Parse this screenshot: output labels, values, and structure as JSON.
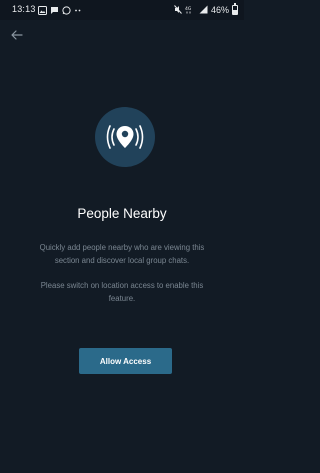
{
  "status_bar": {
    "time": "13:13",
    "battery_text": "46%",
    "battery_level": 0.46,
    "left_icons": [
      "image-icon",
      "message-icon",
      "whatsapp-icon",
      "more-dots-icon"
    ],
    "right_icons": [
      "mute-icon",
      "network-icon",
      "signal-icon",
      "battery-icon"
    ]
  },
  "header": {
    "back_icon": "back-arrow-icon"
  },
  "hero": {
    "icon": "location-pin-icon",
    "circle_color": "#21425a"
  },
  "content": {
    "title": "People Nearby",
    "description": "Quickly add people nearby who are viewing this section and discover local group chats.",
    "hint": "Please switch on location access to enable this feature."
  },
  "actions": {
    "allow_access_label": "Allow Access",
    "button_color": "#2b6a8a"
  },
  "colors": {
    "background": "#121b25",
    "secondary_text": "#7a8691"
  }
}
